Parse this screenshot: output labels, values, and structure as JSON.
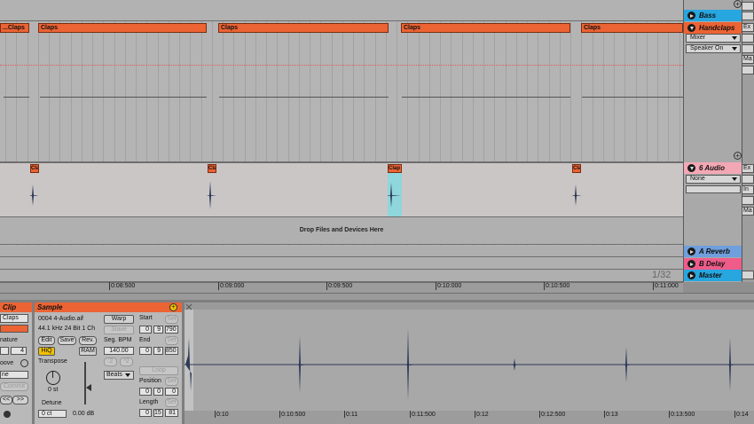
{
  "arrangement": {
    "tracks": {
      "bass": {
        "name": "Bass",
        "color": "#27a6df"
      },
      "handclaps": {
        "name": "Handclaps",
        "color": "#ec6334",
        "input_type": "Mixer",
        "input_channel": "Speaker On",
        "side_label_1": "Ex",
        "side_label_2": "Ma"
      },
      "audio6": {
        "name": "6 Audio",
        "color": "#f3a7b5",
        "input": "None",
        "side_label": "Ex",
        "side_label_2": "In",
        "side_label_3": "Ma"
      },
      "reverb": {
        "name": "A Reverb",
        "color": "#6f9fdc"
      },
      "delay": {
        "name": "B Delay",
        "color": "#ef5c8a"
      },
      "master": {
        "name": "Master",
        "color": "#27a6df"
      }
    },
    "handclap_clips": [
      {
        "label": "...Claps"
      },
      {
        "label": "Claps"
      },
      {
        "label": "Claps"
      },
      {
        "label": "Claps"
      },
      {
        "label": "Claps"
      }
    ],
    "audio_clip_labels": [
      "Cla",
      "Cla",
      "Clap",
      "Cla"
    ],
    "drop_hint": "Drop Files and Devices Here",
    "page_indicator": "1/32",
    "ruler": [
      "0:08:500",
      "0:09:000",
      "0:09:500",
      "0:10:000",
      "0:10:500",
      "0:11:000"
    ]
  },
  "clip_panel": {
    "title": "Clip",
    "name": "Claps",
    "signature_label": "nature",
    "sig_denominator": "4",
    "groove_label": "oove",
    "groove_value": "ne",
    "commit": "Commit",
    "nav_left": "<<",
    "nav_right": ">>"
  },
  "sample_panel": {
    "title": "Sample",
    "file": "0004 4-Audio.aif",
    "format": "44.1 kHz 24 Bit 1 Ch",
    "edit": "Edit",
    "save": "Save",
    "rev": "Rev.",
    "hiq": "HiQ",
    "ram": "RAM",
    "transpose_label": "Transpose",
    "transpose_value": "0 st",
    "detune_label": "Detune",
    "detune_value": "0 ct",
    "volume": "0.00 dB",
    "warp": "Warp",
    "slave": "Slave",
    "seg_bpm_label": "Seg. BPM",
    "seg_bpm": "140.00",
    "half": ":2",
    "double": "*2",
    "warp_mode": "Beats",
    "start_label": "Start",
    "end_label": "End",
    "loop": "Loop",
    "position_label": "Position",
    "length_label": "Length",
    "set": "Set",
    "start": [
      "0",
      "9",
      "790"
    ],
    "end": [
      "0",
      "9",
      "850"
    ],
    "position": [
      "0",
      "0",
      "0"
    ],
    "length": [
      "0",
      "15",
      "81"
    ]
  },
  "waveform": {
    "ruler": [
      "0:10",
      "0:10:500",
      "0:11",
      "0:11:500",
      "0:12",
      "0:12:500",
      "0:13",
      "0:13:500",
      "0:14"
    ]
  }
}
